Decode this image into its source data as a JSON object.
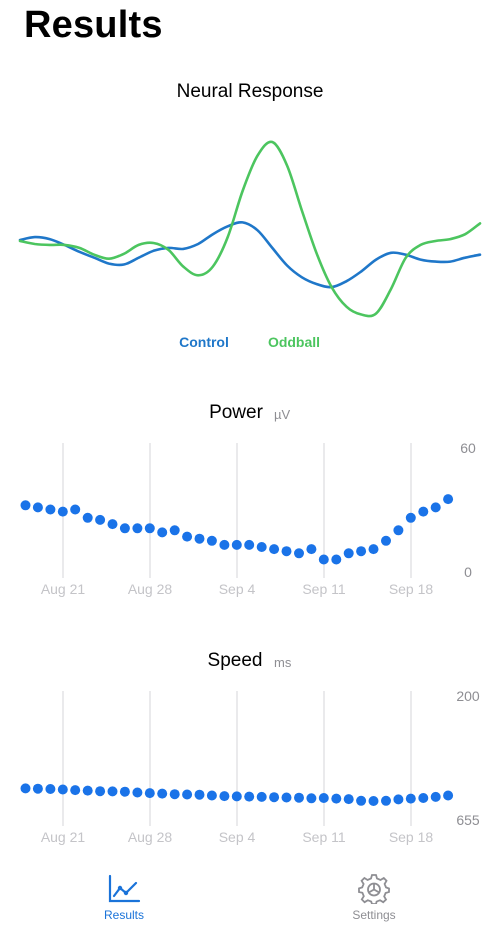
{
  "header": {
    "title": "Results"
  },
  "colors": {
    "accent": "#1a73d9",
    "control": "#1f77c9",
    "oddball": "#4cc55f",
    "dot": "#1a73e8"
  },
  "neural": {
    "title": "Neural Response",
    "legend": [
      "Control",
      "Oddball"
    ]
  },
  "power": {
    "title": "Power",
    "unit": "µV",
    "y_max_label": "60",
    "y_min_label": "0"
  },
  "speed": {
    "title": "Speed",
    "unit": "ms",
    "y_top_label": "200",
    "y_bottom_label": "655"
  },
  "chart_data": [
    {
      "type": "line",
      "title": "Neural Response",
      "x": [
        0,
        1,
        2,
        3,
        4,
        5,
        6,
        7,
        8,
        9,
        10,
        11,
        12,
        13,
        14,
        15,
        16,
        17,
        18,
        19,
        20,
        21,
        22,
        23,
        24,
        25,
        26,
        27,
        28,
        29,
        30,
        31,
        32,
        33,
        34,
        35,
        36,
        37,
        38,
        39,
        40
      ],
      "series": [
        {
          "name": "Control",
          "values": [
            0.2,
            0.5,
            0.3,
            -0.3,
            -1.0,
            -1.6,
            -2.2,
            -2.3,
            -1.6,
            -0.9,
            -0.6,
            -0.7,
            -0.2,
            0.8,
            1.6,
            2.0,
            1.2,
            -0.6,
            -2.4,
            -3.6,
            -4.3,
            -4.6,
            -4.0,
            -3.0,
            -1.8,
            -1.1,
            -1.3,
            -1.8,
            -2.0,
            -2.0,
            -1.6,
            -1.3
          ]
        },
        {
          "name": "Oddball",
          "values": [
            0.1,
            -0.2,
            -0.3,
            -0.3,
            -0.6,
            -1.3,
            -1.7,
            -1.2,
            -0.3,
            -0.1,
            -0.8,
            -2.5,
            -3.4,
            -2.5,
            0.5,
            5.2,
            8.8,
            10.2,
            7.8,
            3.2,
            -1.2,
            -4.6,
            -6.6,
            -7.4,
            -7.3,
            -4.8,
            -1.6,
            -0.3,
            0.1,
            0.3,
            0.8,
            1.9
          ]
        }
      ]
    },
    {
      "type": "scatter",
      "title": "Power",
      "ylabel": "µV",
      "x_tick_labels": [
        "Aug 21",
        "Aug 28",
        "Sep 4",
        "Sep 11",
        "Sep 18"
      ],
      "ylim": [
        0,
        60
      ],
      "x": [
        "Aug 16",
        "Aug 17",
        "Aug 18",
        "Aug 19",
        "Aug 20",
        "Aug 21",
        "Aug 22",
        "Aug 23",
        "Aug 24",
        "Aug 25",
        "Aug 26",
        "Aug 27",
        "Aug 28",
        "Aug 29",
        "Aug 30",
        "Aug 31",
        "Sep 1",
        "Sep 2",
        "Sep 3",
        "Sep 4",
        "Sep 5",
        "Sep 6",
        "Sep 7",
        "Sep 8",
        "Sep 9",
        "Sep 10",
        "Sep 11",
        "Sep 12",
        "Sep 13",
        "Sep 14",
        "Sep 15",
        "Sep 16",
        "Sep 17",
        "Sep 18",
        "Sep 19"
      ],
      "values": [
        32,
        31,
        30,
        29,
        30,
        26,
        25,
        23,
        21,
        21,
        21,
        19,
        20,
        17,
        16,
        15,
        13,
        13,
        13,
        12,
        11,
        10,
        9,
        11,
        6,
        6,
        9,
        10,
        11,
        15,
        20,
        26,
        29,
        31,
        35
      ]
    },
    {
      "type": "scatter",
      "title": "Speed",
      "ylabel": "ms",
      "x_tick_labels": [
        "Aug 21",
        "Aug 28",
        "Sep 4",
        "Sep 11",
        "Sep 18"
      ],
      "y_range_labels": [
        "200",
        "655"
      ],
      "x": [
        "Aug 16",
        "Aug 17",
        "Aug 18",
        "Aug 19",
        "Aug 20",
        "Aug 21",
        "Aug 22",
        "Aug 23",
        "Aug 24",
        "Aug 25",
        "Aug 26",
        "Aug 27",
        "Aug 28",
        "Aug 29",
        "Aug 30",
        "Aug 31",
        "Sep 1",
        "Sep 2",
        "Sep 3",
        "Sep 4",
        "Sep 5",
        "Sep 6",
        "Sep 7",
        "Sep 8",
        "Sep 9",
        "Sep 10",
        "Sep 11",
        "Sep 12",
        "Sep 13",
        "Sep 14",
        "Sep 15",
        "Sep 16",
        "Sep 17",
        "Sep 18",
        "Sep 19"
      ],
      "values": [
        540,
        541,
        542,
        544,
        546,
        548,
        550,
        551,
        552,
        555,
        557,
        559,
        561,
        562,
        563,
        566,
        568,
        569,
        570,
        571,
        572,
        573,
        574,
        576,
        575,
        577,
        579,
        585,
        586,
        585,
        580,
        577,
        575,
        571,
        566
      ]
    }
  ],
  "tabbar": {
    "tabs": [
      {
        "label": "Results",
        "icon": "chart-icon",
        "active": true
      },
      {
        "label": "Settings",
        "icon": "gear-icon",
        "active": false
      }
    ]
  }
}
